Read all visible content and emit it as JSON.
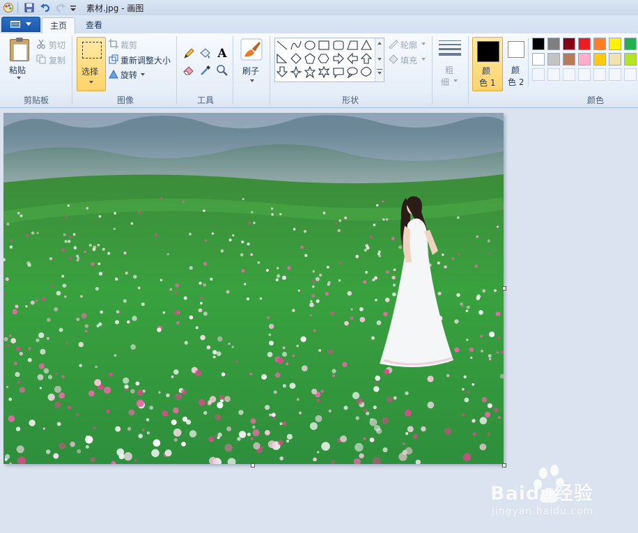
{
  "window": {
    "title": "素材.jpg - 画图"
  },
  "tabs": [
    {
      "label": "主页"
    },
    {
      "label": "查看"
    }
  ],
  "clipboard": {
    "paste_label": "粘贴",
    "cut_label": "剪切",
    "copy_label": "复制",
    "group_label": "剪贴板"
  },
  "image_group": {
    "select_label": "选择",
    "crop_label": "裁剪",
    "resize_label": "重新调整大小",
    "rotate_label": "旋转",
    "group_label": "图像"
  },
  "tools": {
    "group_label": "工具"
  },
  "brushes": {
    "label": "刷子"
  },
  "shapes": {
    "outline_label": "轮廓",
    "fill_label": "填充",
    "group_label": "形状"
  },
  "size": {
    "label_line1": "粗",
    "label_line2": "细"
  },
  "colors": {
    "color1_line1": "颜",
    "color1_line2": "色 1",
    "color2_line1": "颜",
    "color2_line2": "色 2",
    "group_label": "颜色",
    "palette_row1": [
      "#000000",
      "#7f7f7f",
      "#880015",
      "#ed1c24",
      "#ff7f27",
      "#fff200",
      "#22b14c"
    ],
    "palette_row2": [
      "#ffffff",
      "#c3c3c3",
      "#b97a57",
      "#ffaec9",
      "#ffc90e",
      "#efe4b0",
      "#b5e61d"
    ],
    "color1": "#000000",
    "color2": "#ffffff"
  },
  "watermark": {
    "brand": "Baidu经验",
    "url": "jingyan.baidu.com"
  }
}
